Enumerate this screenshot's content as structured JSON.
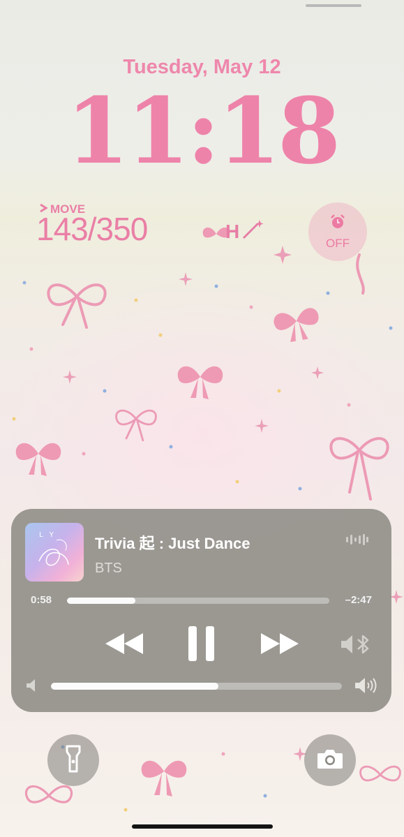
{
  "lock_screen": {
    "date": "Tuesday, May 12",
    "time": "11:18"
  },
  "widgets": {
    "move": {
      "label": "MOVE",
      "value": "143/350",
      "icon": "arrow-icon"
    },
    "h_widget": {
      "label": "H",
      "icon": "magic-wand-icon"
    },
    "alarm": {
      "label": "OFF",
      "icon": "alarm-clock-icon"
    }
  },
  "now_playing": {
    "title": "Trivia 起 : Just Dance",
    "artist": "BTS",
    "artwork_text": "L Y ✿",
    "elapsed": "0:58",
    "remaining": "–2:47",
    "progress_fraction": 0.26,
    "volume_fraction": 0.575,
    "controls": [
      "rewind-icon",
      "pause-icon",
      "fast-forward-icon"
    ],
    "output_icon": "bluetooth-speaker-icon",
    "waveform_icon": "waveform-icon"
  },
  "quick_actions": {
    "left": "flashlight-icon",
    "right": "camera-icon"
  },
  "colors": {
    "accent_pink": "#ee83aa",
    "player_bg": "#82807a"
  }
}
